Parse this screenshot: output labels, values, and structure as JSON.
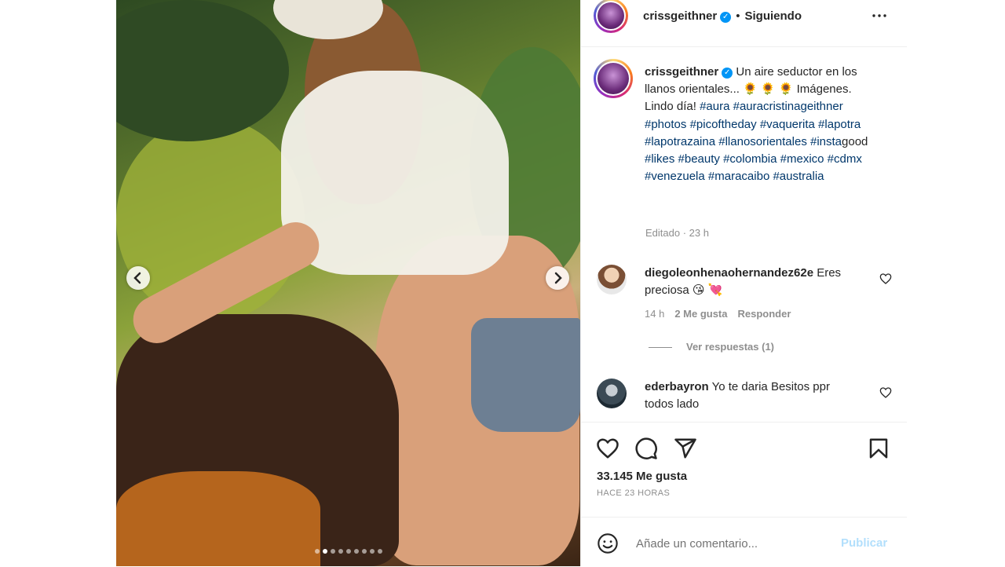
{
  "post": {
    "username": "crissgeithner",
    "follow_state": "Siguiendo",
    "separator": "•",
    "more_icon": "more-horizontal-icon"
  },
  "caption": {
    "username": "crissgeithner",
    "lines": [
      "Un aire seductor en",
      "los llanos orientales... 🌻 🌻 🌻",
      "Imágenes. Lindo día!"
    ],
    "hashtags_line1": [
      "#aura"
    ],
    "hashtags_line2": [
      "#auracristinageithner",
      "#photos"
    ],
    "hashtags_line3": [
      "#picoftheday",
      "#vaquerita",
      "#lapotra"
    ],
    "hashtags_line4": [
      "#lapotrazaina",
      "#llanosorientales",
      "#insta"
    ],
    "good_text": "good",
    "hashtags_line5": [
      "#likes",
      "#beauty",
      "#colombia"
    ],
    "hashtags_line6": [
      "#mexico",
      "#cdmx",
      "#venezuela"
    ],
    "hashtags_line7": [
      "#maracaibo",
      "#australia"
    ],
    "meta": "Editado · 23 h"
  },
  "comments": [
    {
      "username": "diegoleonhenaohernandez62e",
      "text": "Eres preciosa 😘 💘",
      "time": "14 h",
      "likes": "2 Me gusta",
      "reply": "Responder",
      "view_replies": "Ver respuestas (1)"
    },
    {
      "username": "ederbayron",
      "text": "Yo te daria Besitos ppr todos lado"
    }
  ],
  "actions": {
    "like_icon": "heart-icon",
    "comment_icon": "comment-icon",
    "share_icon": "send-icon",
    "save_icon": "bookmark-icon",
    "likes_count": "33.145 Me gusta",
    "time_ago": "HACE 23 HORAS"
  },
  "comment_bar": {
    "placeholder": "Añade un comentario...",
    "publish": "Publicar"
  },
  "carousel": {
    "slide_count": 9,
    "active_index": 1
  },
  "colors": {
    "link": "#00376b",
    "verified": "#0095f6",
    "muted": "#8e8e8e",
    "publish_disabled": "#b2dffc"
  }
}
